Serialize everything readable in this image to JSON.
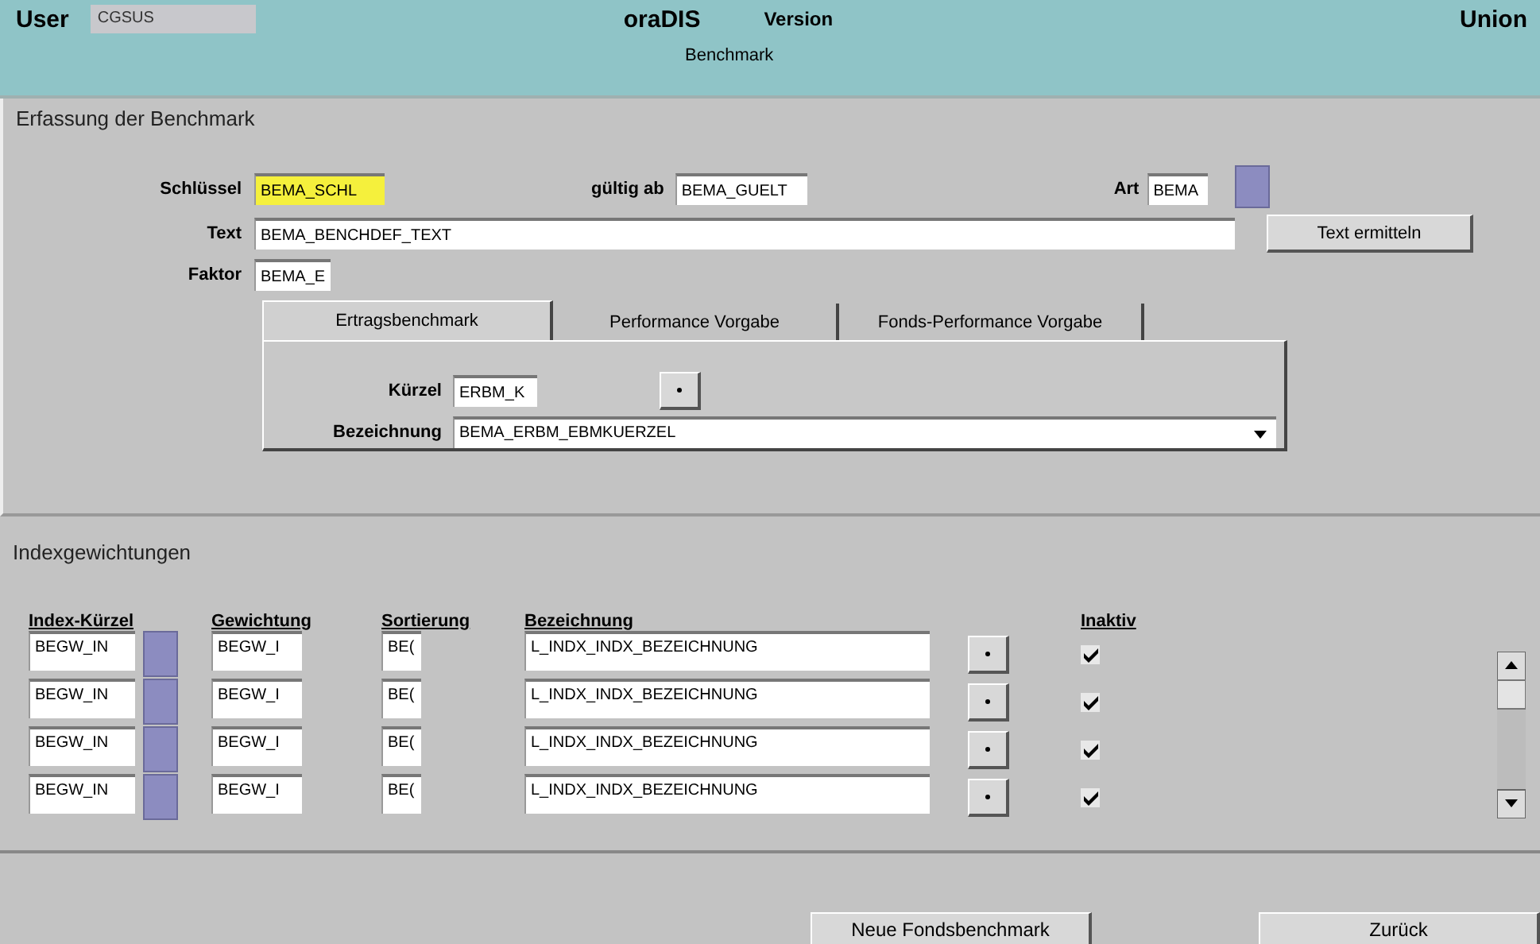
{
  "header": {
    "user_label": "User",
    "user_value": "CGSUS",
    "app_title": "oraDIS",
    "version_label": "Version",
    "company": "Union",
    "subtitle": "Benchmark"
  },
  "benchmark": {
    "title": "Erfassung der Benchmark",
    "schluessel": {
      "label": "Schlüssel",
      "value": "BEMA_SCHL"
    },
    "gueltig_ab": {
      "label": "gültig ab",
      "value": "BEMA_GUELT"
    },
    "art": {
      "label": "Art",
      "value": "BEMA"
    },
    "text": {
      "label": "Text",
      "value": "BEMA_BENCHDEF_TEXT"
    },
    "text_button": "Text ermitteln",
    "faktor": {
      "label": "Faktor",
      "value": "BEMA_E"
    },
    "tabs": [
      {
        "label": "Ertragsbenchmark",
        "selected": true
      },
      {
        "label": "Performance Vorgabe",
        "selected": false
      },
      {
        "label": "Fonds-Performance Vorgabe",
        "selected": false
      }
    ],
    "kuerzel": {
      "label": "Kürzel",
      "value": "ERBM_K"
    },
    "bezeichnung": {
      "label": "Bezeichnung",
      "value": "BEMA_ERBM_EBMKUERZEL"
    }
  },
  "index": {
    "title": "Indexgewichtungen",
    "columns": [
      "Index-Kürzel",
      "Gewichtung",
      "Sortierung",
      "Bezeichnung",
      "Inaktiv"
    ],
    "rows": [
      {
        "index_kuerzel": "BEGW_IN",
        "gewichtung": "BEGW_I",
        "sortierung": "BE(",
        "bezeichnung": "L_INDX_INDX_BEZEICHNUNG",
        "inaktiv": true
      },
      {
        "index_kuerzel": "BEGW_IN",
        "gewichtung": "BEGW_I",
        "sortierung": "BE(",
        "bezeichnung": "L_INDX_INDX_BEZEICHNUNG",
        "inaktiv": true
      },
      {
        "index_kuerzel": "BEGW_IN",
        "gewichtung": "BEGW_I",
        "sortierung": "BE(",
        "bezeichnung": "L_INDX_INDX_BEZEICHNUNG",
        "inaktiv": true
      },
      {
        "index_kuerzel": "BEGW_IN",
        "gewichtung": "BEGW_I",
        "sortierung": "BE(",
        "bezeichnung": "L_INDX_INDX_BEZEICHNUNG",
        "inaktiv": true
      }
    ]
  },
  "footer_buttons": [
    "Neue Fondsbenchmark",
    "Zurück"
  ]
}
